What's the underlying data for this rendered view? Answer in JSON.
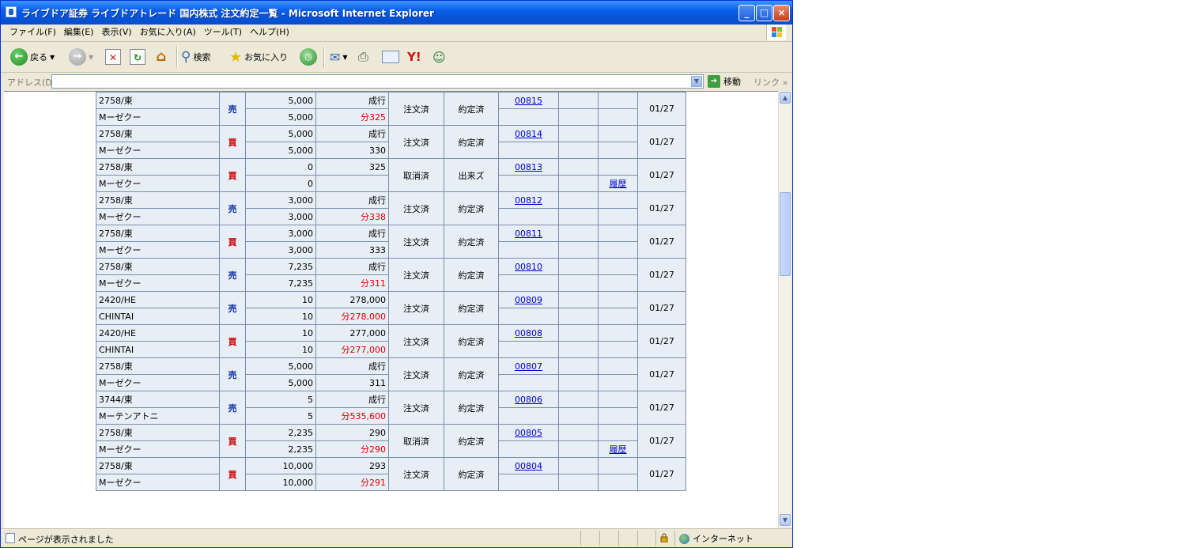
{
  "window": {
    "title": "ライブドア証券 ライブドアトレード 国内株式 注文約定一覧 - Microsoft Internet Explorer",
    "minimize": "_",
    "maximize": "□",
    "close": "×"
  },
  "menu": {
    "items": [
      "ファイル(F)",
      "編集(E)",
      "表示(V)",
      "お気に入り(A)",
      "ツール(T)",
      "ヘルプ(H)"
    ]
  },
  "toolbar": {
    "back_label": "戻る",
    "search_label": "検索",
    "favorites_label": "お気に入り"
  },
  "address": {
    "label": "アドレス(D)",
    "value": "",
    "go_label": "移動",
    "links_label": "リンク"
  },
  "status": {
    "text": "ページが表示されました",
    "zone": "インターネット"
  },
  "orders": [
    {
      "code": "2758/東",
      "name": "Mーゼクー",
      "side": "売",
      "side_type": "sell",
      "qty": "5,000",
      "qty_exec": "5,000",
      "price": "成行",
      "exec_prefix": "分",
      "exec_price": "325",
      "order_status": "注文済",
      "exec_status": "約定済",
      "order_no": "00815",
      "history": "",
      "date": "01/27"
    },
    {
      "code": "2758/東",
      "name": "Mーゼクー",
      "side": "買",
      "side_type": "buy",
      "qty": "5,000",
      "qty_exec": "5,000",
      "price": "成行",
      "exec_prefix": "",
      "exec_price": "330",
      "order_status": "注文済",
      "exec_status": "約定済",
      "order_no": "00814",
      "history": "",
      "date": "01/27"
    },
    {
      "code": "2758/東",
      "name": "Mーゼクー",
      "side": "買",
      "side_type": "buy",
      "qty": "0",
      "qty_exec": "0",
      "price": "325",
      "exec_prefix": "",
      "exec_price": "",
      "order_status": "取消済",
      "exec_status": "出来ズ",
      "order_no": "00813",
      "history": "履歴",
      "date": "01/27"
    },
    {
      "code": "2758/東",
      "name": "Mーゼクー",
      "side": "売",
      "side_type": "sell",
      "qty": "3,000",
      "qty_exec": "3,000",
      "price": "成行",
      "exec_prefix": "分",
      "exec_price": "338",
      "order_status": "注文済",
      "exec_status": "約定済",
      "order_no": "00812",
      "history": "",
      "date": "01/27"
    },
    {
      "code": "2758/東",
      "name": "Mーゼクー",
      "side": "買",
      "side_type": "buy",
      "qty": "3,000",
      "qty_exec": "3,000",
      "price": "成行",
      "exec_prefix": "",
      "exec_price": "333",
      "order_status": "注文済",
      "exec_status": "約定済",
      "order_no": "00811",
      "history": "",
      "date": "01/27"
    },
    {
      "code": "2758/東",
      "name": "Mーゼクー",
      "side": "売",
      "side_type": "sell",
      "qty": "7,235",
      "qty_exec": "7,235",
      "price": "成行",
      "exec_prefix": "分",
      "exec_price": "311",
      "order_status": "注文済",
      "exec_status": "約定済",
      "order_no": "00810",
      "history": "",
      "date": "01/27"
    },
    {
      "code": "2420/HE",
      "name": "CHINTAI",
      "side": "売",
      "side_type": "sell",
      "qty": "10",
      "qty_exec": "10",
      "price": "278,000",
      "exec_prefix": "分",
      "exec_price": "278,000",
      "order_status": "注文済",
      "exec_status": "約定済",
      "order_no": "00809",
      "history": "",
      "date": "01/27"
    },
    {
      "code": "2420/HE",
      "name": "CHINTAI",
      "side": "買",
      "side_type": "buy",
      "qty": "10",
      "qty_exec": "10",
      "price": "277,000",
      "exec_prefix": "分",
      "exec_price": "277,000",
      "order_status": "注文済",
      "exec_status": "約定済",
      "order_no": "00808",
      "history": "",
      "date": "01/27"
    },
    {
      "code": "2758/東",
      "name": "Mーゼクー",
      "side": "売",
      "side_type": "sell",
      "qty": "5,000",
      "qty_exec": "5,000",
      "price": "成行",
      "exec_prefix": "",
      "exec_price": "311",
      "order_status": "注文済",
      "exec_status": "約定済",
      "order_no": "00807",
      "history": "",
      "date": "01/27"
    },
    {
      "code": "3744/東",
      "name": "Mーテンアトニ",
      "side": "売",
      "side_type": "sell",
      "qty": "5",
      "qty_exec": "5",
      "price": "成行",
      "exec_prefix": "分",
      "exec_price": "535,600",
      "order_status": "注文済",
      "exec_status": "約定済",
      "order_no": "00806",
      "history": "",
      "date": "01/27"
    },
    {
      "code": "2758/東",
      "name": "Mーゼクー",
      "side": "買",
      "side_type": "buy",
      "qty": "2,235",
      "qty_exec": "2,235",
      "price": "290",
      "exec_prefix": "分",
      "exec_price": "290",
      "order_status": "取消済",
      "exec_status": "約定済",
      "order_no": "00805",
      "history": "履歴",
      "date": "01/27"
    },
    {
      "code": "2758/東",
      "name": "Mーゼクー",
      "side": "買",
      "side_type": "buy",
      "qty": "10,000",
      "qty_exec": "10,000",
      "price": "293",
      "exec_prefix": "分",
      "exec_price": "291",
      "order_status": "注文済",
      "exec_status": "約定済",
      "order_no": "00804",
      "history": "",
      "date": "01/27"
    }
  ],
  "colors": {
    "titlebar": "#0a5fe8",
    "buy": "#cc0000",
    "sell": "#0b2ea8",
    "cell_bg": "#e8eef6",
    "link": "#0000cc"
  }
}
